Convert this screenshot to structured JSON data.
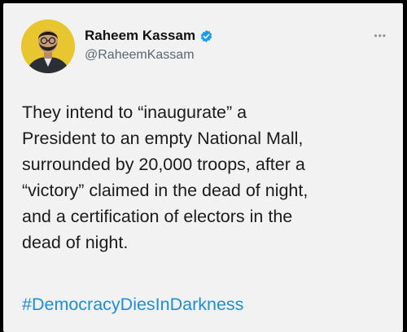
{
  "tweet": {
    "author": {
      "display_name": "Raheem Kassam",
      "handle": "@RaheemKassam",
      "verified": true,
      "avatar_bg_color": "#e8c630"
    },
    "more_icon": "more-dots-icon",
    "text": "They intend to “inaugurate” a\nPresident to an empty National Mall,\nsurrounded by 20,000 troops, after a\n“victory” claimed in the dead of night,\nand a certification of electors in the\ndead of night.",
    "hashtag": "#DemocracyDiesInDarkness",
    "hashtag_color": "#1d8fd8",
    "verified_color": "#1d9bf0"
  }
}
